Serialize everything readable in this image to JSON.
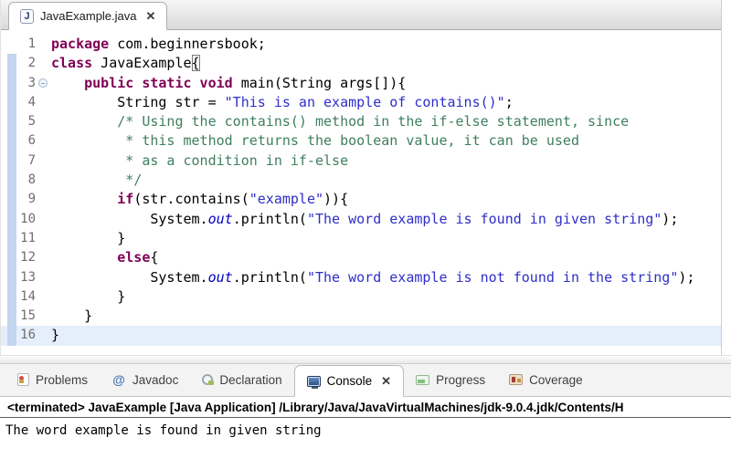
{
  "editor": {
    "tab": {
      "title": "JavaExample.java",
      "icon_letter": "J"
    },
    "fold_marker_line": 3,
    "current_line": 16,
    "lines": [
      {
        "n": 1,
        "segs": [
          {
            "t": "package",
            "c": "kw"
          },
          {
            "t": " com.beginnersbook;",
            "c": "pl"
          }
        ]
      },
      {
        "n": 2,
        "segs": [
          {
            "t": "class",
            "c": "kw"
          },
          {
            "t": " JavaExample",
            "c": "pl"
          },
          {
            "t": "{",
            "c": "pl brk"
          }
        ]
      },
      {
        "n": 3,
        "segs": [
          {
            "t": "    ",
            "c": "pl"
          },
          {
            "t": "public static void",
            "c": "kw"
          },
          {
            "t": " main(String args[]){",
            "c": "pl"
          }
        ]
      },
      {
        "n": 4,
        "segs": [
          {
            "t": "        String str = ",
            "c": "pl"
          },
          {
            "t": "\"This is an example of contains()\"",
            "c": "str"
          },
          {
            "t": ";",
            "c": "pl"
          }
        ]
      },
      {
        "n": 5,
        "segs": [
          {
            "t": "        ",
            "c": "pl"
          },
          {
            "t": "/* Using the contains() method in the if-else statement, since",
            "c": "com"
          }
        ]
      },
      {
        "n": 6,
        "segs": [
          {
            "t": "         ",
            "c": "pl"
          },
          {
            "t": "* this method returns the boolean value, it can be used",
            "c": "com"
          }
        ]
      },
      {
        "n": 7,
        "segs": [
          {
            "t": "         ",
            "c": "pl"
          },
          {
            "t": "* as a condition in if-else",
            "c": "com"
          }
        ]
      },
      {
        "n": 8,
        "segs": [
          {
            "t": "         ",
            "c": "pl"
          },
          {
            "t": "*/",
            "c": "com"
          }
        ]
      },
      {
        "n": 9,
        "segs": [
          {
            "t": "        ",
            "c": "pl"
          },
          {
            "t": "if",
            "c": "kw"
          },
          {
            "t": "(str.contains(",
            "c": "pl"
          },
          {
            "t": "\"example\"",
            "c": "str"
          },
          {
            "t": ")){",
            "c": "pl"
          }
        ]
      },
      {
        "n": 10,
        "segs": [
          {
            "t": "            System.",
            "c": "pl"
          },
          {
            "t": "out",
            "c": "fld"
          },
          {
            "t": ".println(",
            "c": "pl"
          },
          {
            "t": "\"The word example is found in given string\"",
            "c": "str"
          },
          {
            "t": ");",
            "c": "pl"
          }
        ]
      },
      {
        "n": 11,
        "segs": [
          {
            "t": "        }",
            "c": "pl"
          }
        ]
      },
      {
        "n": 12,
        "segs": [
          {
            "t": "        ",
            "c": "pl"
          },
          {
            "t": "else",
            "c": "kw"
          },
          {
            "t": "{",
            "c": "pl"
          }
        ]
      },
      {
        "n": 13,
        "segs": [
          {
            "t": "            System.",
            "c": "pl"
          },
          {
            "t": "out",
            "c": "fld"
          },
          {
            "t": ".println(",
            "c": "pl"
          },
          {
            "t": "\"The word example is not found in the string\"",
            "c": "str"
          },
          {
            "t": ");",
            "c": "pl"
          }
        ]
      },
      {
        "n": 14,
        "segs": [
          {
            "t": "        }",
            "c": "pl"
          }
        ]
      },
      {
        "n": 15,
        "segs": [
          {
            "t": "    }",
            "c": "pl"
          }
        ]
      },
      {
        "n": 16,
        "segs": [
          {
            "t": "}",
            "c": "pl"
          }
        ]
      }
    ]
  },
  "bottom_panel": {
    "tabs": [
      {
        "label": "Problems",
        "icon": "problems-icon",
        "active": false,
        "closable": false
      },
      {
        "label": "Javadoc",
        "icon": "javadoc-icon",
        "active": false,
        "closable": false
      },
      {
        "label": "Declaration",
        "icon": "declaration-icon",
        "active": false,
        "closable": false
      },
      {
        "label": "Console",
        "icon": "console-icon",
        "active": true,
        "closable": true
      },
      {
        "label": "Progress",
        "icon": "progress-icon",
        "active": false,
        "closable": false
      },
      {
        "label": "Coverage",
        "icon": "coverage-icon",
        "active": false,
        "closable": false
      }
    ],
    "console": {
      "header": "<terminated> JavaExample [Java Application] /Library/Java/JavaVirtualMachines/jdk-9.0.4.jdk/Contents/H",
      "output": "The word example is found in given string"
    }
  },
  "glyphs": {
    "close": "✕"
  },
  "colors": {
    "kw": "#7f0055",
    "str": "#2e2ec9",
    "com": "#3f7f5f",
    "fld": "#0000c0",
    "diffbar": "#c3d6ee",
    "curline": "#e5effb",
    "lineno": "#6f6f6f"
  }
}
